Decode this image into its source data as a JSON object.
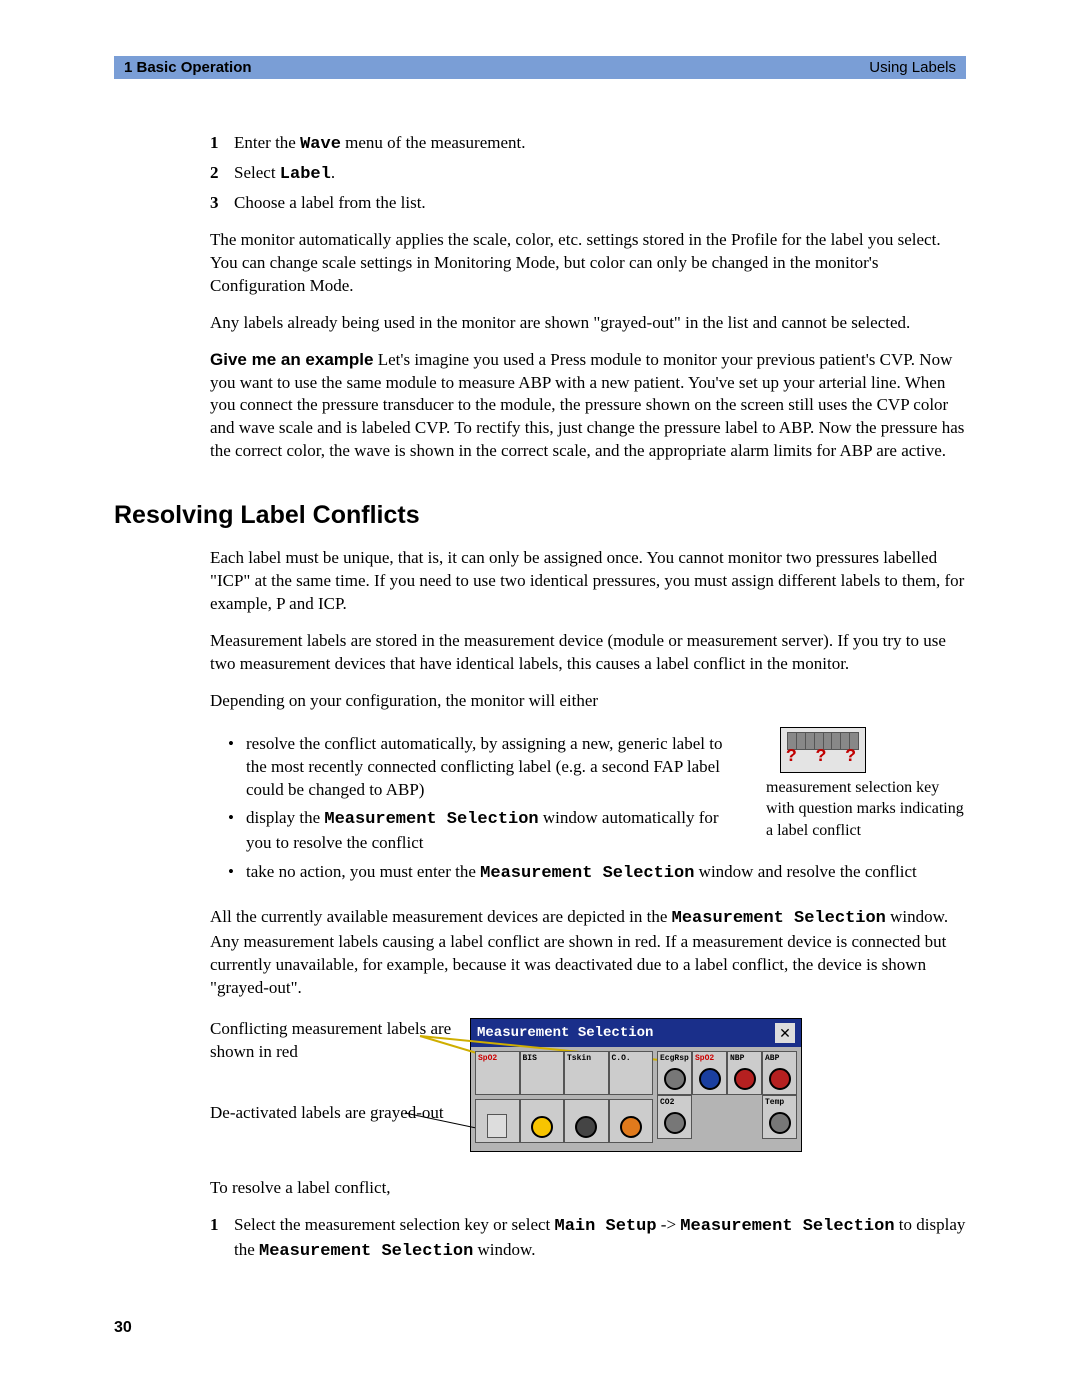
{
  "header": {
    "left": "1  Basic Operation",
    "right": "Using Labels"
  },
  "steps_intro": [
    {
      "num": "1",
      "pre": "Enter the ",
      "bold": "Wave",
      "post": " menu of the measurement."
    },
    {
      "num": "2",
      "pre": "Select ",
      "bold": "Label",
      "post": "."
    },
    {
      "num": "3",
      "pre": "Choose a label from the list.",
      "bold": "",
      "post": ""
    }
  ],
  "paras": {
    "p1": "The monitor automatically applies the scale, color, etc. settings stored in the Profile for the label you select. You can change scale settings in Monitoring Mode, but color can only be changed in the monitor's Configuration Mode.",
    "p2": "Any labels already being used in the monitor are shown \"grayed-out\" in the list and cannot be selected.",
    "p3_lead": "Give me an example",
    "p3_body": "  Let's imagine you used a Press module to monitor your previous patient's CVP. Now you want to use the same module to measure ABP with a new patient. You've set up your arterial line. When you connect the pressure transducer to the module, the pressure shown on the screen still uses the CVP color and wave scale and is labeled CVP. To rectify this, just change the pressure label to ABP. Now the pressure has the correct color, the wave is shown in the correct scale, and the appropriate alarm limits for ABP are active."
  },
  "section_heading": "Resolving Label Conflicts",
  "resolve": {
    "p1": "Each label must be unique, that is, it can only be assigned once. You cannot monitor two pressures labelled \"ICP\" at the same time. If you need to use two identical pressures, you must assign different labels to them, for example, P and ICP.",
    "p2": "Measurement labels are stored in the measurement device (module or measurement server). If you try to use two measurement devices that have identical labels, this causes a label conflict in the monitor.",
    "p3": "Depending on your configuration, the monitor will either",
    "bullets": [
      "resolve the conflict automatically, by assigning a new, generic label to the most recently connected conflicting label (e.g. a second FAP label could be changed to ABP)",
      "__b2__",
      "__b3__"
    ],
    "b2_pre": "display the ",
    "b2_bold": "Measurement Selection",
    "b2_post": " window automatically for you to resolve the conflict",
    "b3_pre": "take no action, you must enter the ",
    "b3_bold": "Measurement Selection",
    "b3_post": " window and resolve the conflict",
    "p4_pre": "All the currently available measurement devices are depicted in the ",
    "p4_bold": "Measurement Selection",
    "p4_post": " window. Any measurement labels causing a label conflict are shown in red. If a measurement device is connected but currently unavailable, for example, because it was deactivated due to a label conflict, the device is shown \"grayed-out\".",
    "figcap": "measurement selection key with question marks indicating a label conflict",
    "qmarks": "? ? ?",
    "annot1": "Conflicting measurement labels are shown in red",
    "annot2": "De-activated labels are grayed-out",
    "window_title": "Measurement Selection",
    "labels_row1": [
      "SpO2",
      "BIS",
      "Tskin",
      "C.O."
    ],
    "labels_right_top": [
      "EcgRsp",
      "SpO2",
      "NBP",
      "ABP"
    ],
    "labels_right_bottom": [
      "CO2",
      "",
      "",
      "Temp"
    ],
    "p5": "To resolve a label conflict,",
    "step1_num": "1",
    "step1_a": "Select the measurement selection key or select ",
    "step1_b": "Main Setup",
    "step1_c": " -> ",
    "step1_d": "Measurement Selection",
    "step1_e": " to display the ",
    "step1_f": "Measurement Selection",
    "step1_g": " window."
  },
  "page_number": "30"
}
